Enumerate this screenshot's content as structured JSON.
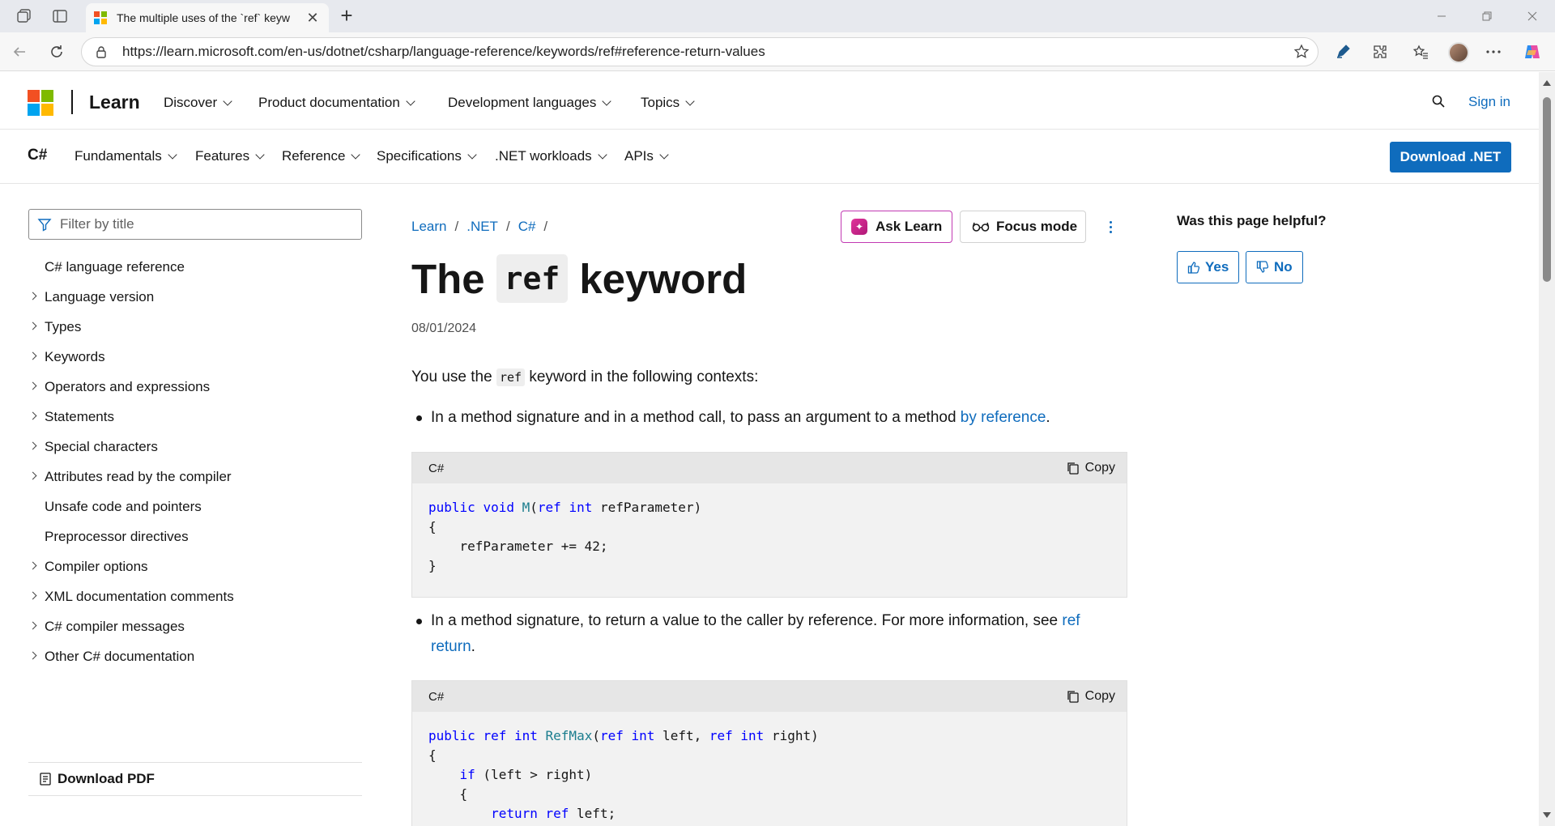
{
  "browser": {
    "tab_title": "The multiple uses of the `ref` keyw",
    "url": "https://learn.microsoft.com/en-us/dotnet/csharp/language-reference/keywords/ref#reference-return-values"
  },
  "global_header": {
    "brand": "Learn",
    "nav": [
      "Discover",
      "Product documentation",
      "Development languages",
      "Topics"
    ],
    "sign_in": "Sign in"
  },
  "csharp_header": {
    "title": "C#",
    "nav": [
      "Fundamentals",
      "Features",
      "Reference",
      "Specifications",
      ".NET workloads",
      "APIs"
    ],
    "download": "Download .NET"
  },
  "toc": {
    "filter_placeholder": "Filter by title",
    "items": [
      {
        "label": "C# language reference",
        "expandable": false
      },
      {
        "label": "Language version",
        "expandable": true
      },
      {
        "label": "Types",
        "expandable": true
      },
      {
        "label": "Keywords",
        "expandable": true
      },
      {
        "label": "Operators and expressions",
        "expandable": true
      },
      {
        "label": "Statements",
        "expandable": true
      },
      {
        "label": "Special characters",
        "expandable": true
      },
      {
        "label": "Attributes read by the compiler",
        "expandable": true
      },
      {
        "label": "Unsafe code and pointers",
        "expandable": false
      },
      {
        "label": "Preprocessor directives",
        "expandable": false
      },
      {
        "label": "Compiler options",
        "expandable": true
      },
      {
        "label": "XML documentation comments",
        "expandable": true
      },
      {
        "label": "C# compiler messages",
        "expandable": true
      },
      {
        "label": "Other C# documentation",
        "expandable": true
      }
    ],
    "download_pdf": "Download PDF"
  },
  "article": {
    "breadcrumbs": [
      "Learn",
      ".NET",
      "C#"
    ],
    "ask_learn": "Ask Learn",
    "focus_mode": "Focus mode",
    "title_before": "The",
    "title_code": "ref",
    "title_after": "keyword",
    "date": "08/01/2024",
    "intro_before": "You use the",
    "intro_code": "ref",
    "intro_after": "keyword in the following contexts:",
    "bullet1_text": "In a method signature and in a method call, to pass an argument to a method",
    "bullet1_link": "by reference",
    "bullet1_end": ".",
    "bullet2_text": "In a method signature, to return a value to the caller by reference. For more information, see",
    "bullet2_link": "ref return",
    "bullet2_end": ".",
    "code_lang": "C#",
    "copy_label": "Copy"
  },
  "feedback": {
    "question": "Was this page helpful?",
    "yes": "Yes",
    "no": "No"
  },
  "colors": {
    "accent": "#0f6cbd",
    "ms_red": "#f25022",
    "ms_green": "#7fba00",
    "ms_blue": "#00a4ef",
    "ms_yellow": "#ffb900"
  }
}
